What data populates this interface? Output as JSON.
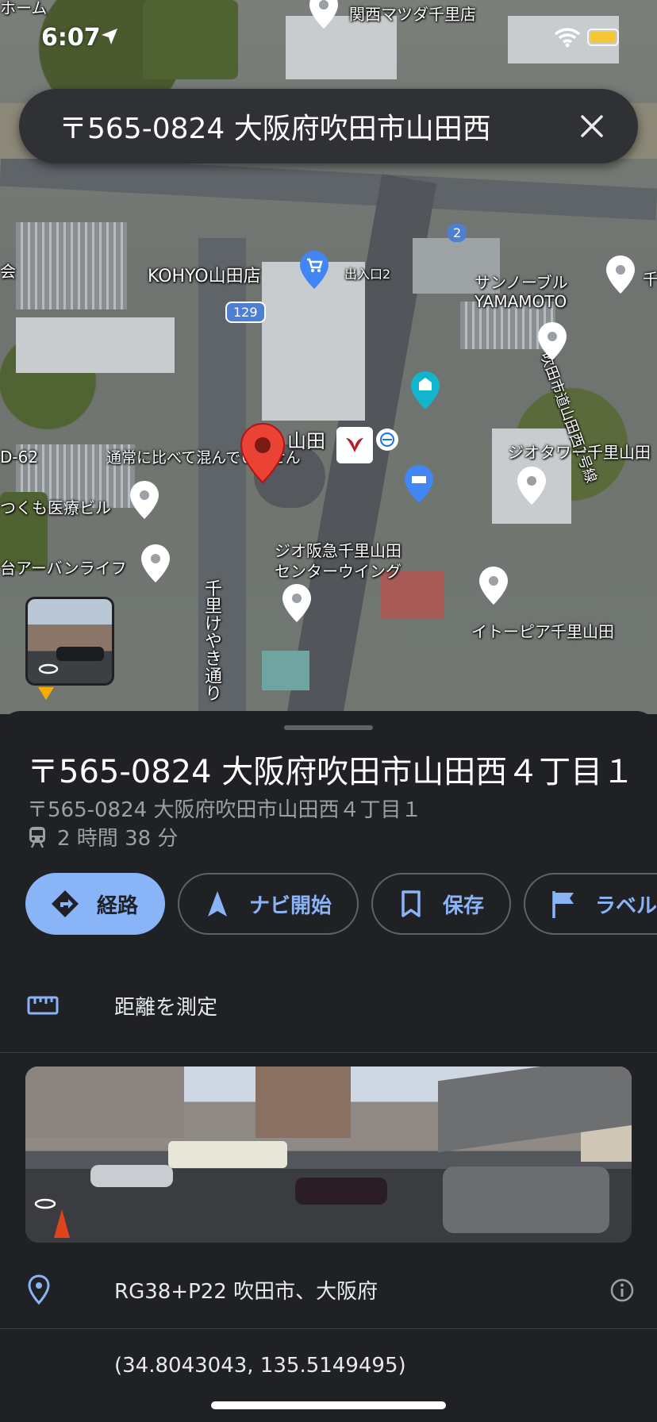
{
  "status_bar": {
    "time": "6:07"
  },
  "search": {
    "query": "〒565-0824 大阪府吹田市山田西"
  },
  "map": {
    "labels": {
      "top_left": "ホーム",
      "kansai_mazda": "関西マツダ千里店",
      "kohyo": "KOHYO山田店",
      "entrance": "出入口2",
      "sunnoble": "サンノーブル",
      "yamamoto": "YAMAMOTO",
      "road_129": "129",
      "badge_2": "2",
      "route_1": "吹田市道山田西1号線",
      "yamada_station": "山田",
      "traffic_note": "通常に比べて混んでいません",
      "gio_tower": "ジオタワー千里山田",
      "tsukumo": "つくも医療ビル",
      "d62": "D-62",
      "urban_life": "台アーバンライフ",
      "gio_center": "ジオ阪急千里山田",
      "center_wing": "センターウイング",
      "itopia": "イトーピア千里山田",
      "senri_keyaki": "千里けやき通り",
      "left_edge": "会",
      "right_edge": "千"
    }
  },
  "place": {
    "title": "〒565-0824 大阪府吹田市山田西４丁目１",
    "subtitle": "〒565-0824 大阪府吹田市山田西４丁目１",
    "transit_time": "2 時間 38 分"
  },
  "actions": [
    {
      "label": "経路",
      "icon": "directions-icon"
    },
    {
      "label": "ナビ開始",
      "icon": "navigation-arrow-icon"
    },
    {
      "label": "保存",
      "icon": "bookmark-icon"
    },
    {
      "label": "ラベルを",
      "icon": "flag-icon"
    }
  ],
  "measure": {
    "label": "距離を測定"
  },
  "plus_code": {
    "text": "RG38+P22 吹田市、大阪府"
  },
  "coordinates": {
    "text": "(34.8043043, 135.5149495)"
  },
  "colors": {
    "accent": "#8ab4f8",
    "sheet_bg": "#202124",
    "pin_red": "#ea4335"
  }
}
